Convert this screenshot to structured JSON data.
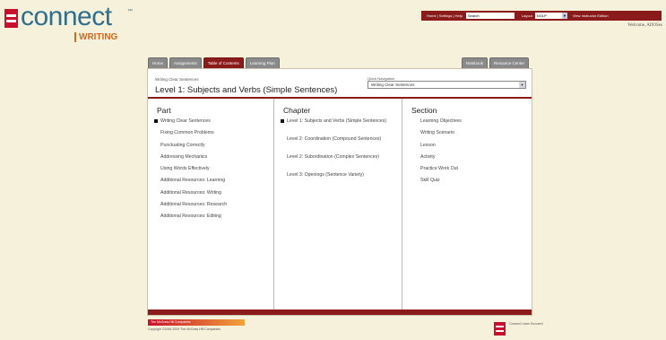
{
  "brand": {
    "name": "connect",
    "trademark": "™",
    "product": "WRITING",
    "brand_color": "#2f6e8c",
    "accent_color": "#d2691e",
    "logo_icon": "mcgraw-hill-logo-icon"
  },
  "topbar": {
    "links": "Home | Settings | Help",
    "search_value": "Search",
    "layout_label": "Layout",
    "layout_value": "NOLP",
    "view_label": "View Instructor Edition",
    "welcome": "Welcome, ADOSes"
  },
  "tabs": {
    "left": [
      "Home",
      "Assignments",
      "Table of Contents",
      "Learning Plan"
    ],
    "right": [
      "Notebook",
      "Resource Center"
    ],
    "active": "Table of Contents"
  },
  "panel": {
    "breadcrumb": "Writing Clear Sentences",
    "title": "Level 1: Subjects and Verbs (Simple Sentences)",
    "quicknav_label": "Quick Navigation",
    "quicknav_value": "Writing Clear Sentences",
    "theme_color": "#8b1b1b"
  },
  "columns": {
    "part": {
      "heading": "Part",
      "items": [
        "Writing Clear Sentences",
        "Fixing Common Problems",
        "Punctuating Correctly",
        "Addressing Mechanics",
        "Using Words Effectively",
        "Additional Resources: Learning",
        "Additional Resources: Writing",
        "Additional Resources: Research",
        "Additional Resources: Editing"
      ]
    },
    "chapter": {
      "heading": "Chapter",
      "items": [
        "Level 1: Subjects and Verbs (Simple Sentences)",
        "Level 2: Coordination (Compound Sentences)",
        "Level 2: Subordination (Complex Sentences)",
        "Level 3: Openings (Sentence Variety)"
      ]
    },
    "section": {
      "heading": "Section",
      "items": [
        "Learning Objectives",
        "Writing Scenario",
        "Lesson",
        "Activity",
        "Practice Work Out",
        "Skill Quiz"
      ]
    }
  },
  "footer": {
    "bar_text": "The McGraw-Hill Companies",
    "copyright": "Copyright ©2006-2009 The McGraw-Hill Companies",
    "clr": "Connect Learn Succeed"
  }
}
